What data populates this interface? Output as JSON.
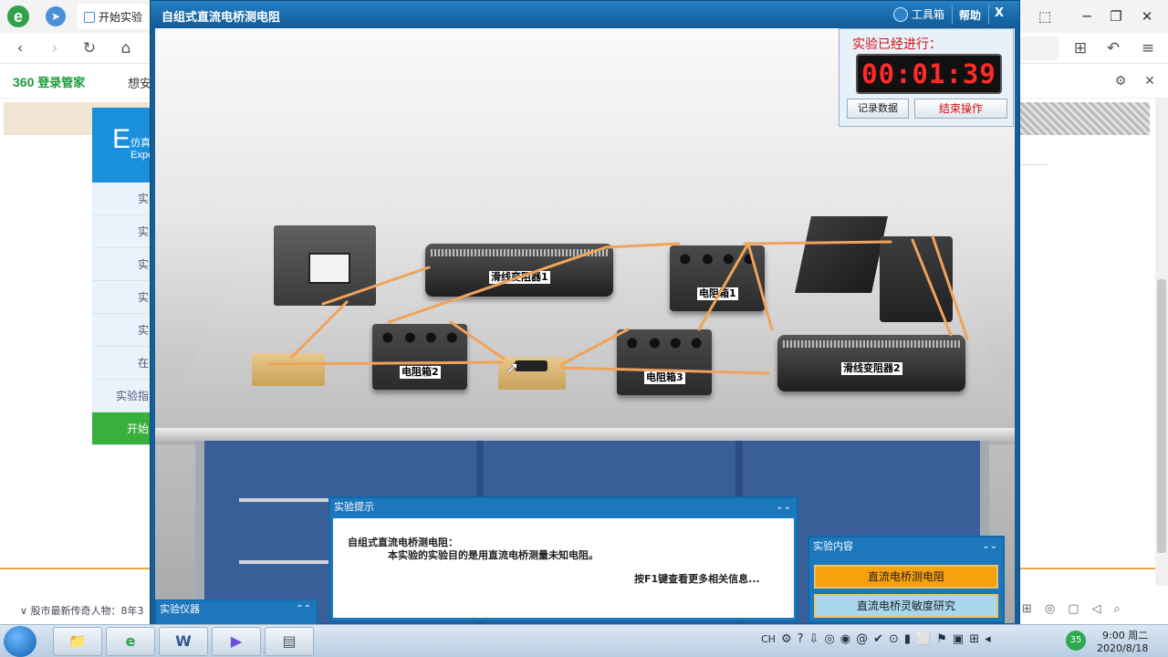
{
  "browser": {
    "logo_glyph": "e",
    "tab_title": "开始实验",
    "window_controls": [
      "⬚",
      "─",
      "❐",
      "✕"
    ],
    "toolbar": {
      "back": "‹",
      "forward": "›",
      "reload": "↻",
      "home": "⌂",
      "apps": "⊞",
      "undo": "↶",
      "menu": "≡"
    },
    "bookmarks": {
      "brand": "360",
      "login": "登录管家",
      "item": "想安",
      "settings": "⚙",
      "close": "✕"
    }
  },
  "background_page": {
    "logo_letter": "E",
    "logo_text_top": "仿真",
    "logo_text_bottom": "Expe",
    "side_items": [
      "实",
      "实",
      "实",
      "实",
      "实",
      "在",
      "实验指"
    ],
    "start_item": "开始",
    "ticker": "股市最新传奇人物：8年3"
  },
  "simulation": {
    "title": "自组式直流电桥测电阻",
    "toolbox_label": "工具箱",
    "help_label": "帮助",
    "close_label": "X",
    "timer": {
      "label": "实验已经进行：",
      "value": "00:01:39",
      "record_button": "记录数据",
      "end_button": "结束操作"
    },
    "devices": {
      "rheostat1": "滑线变阻器1",
      "rheostat2": "滑线变阻器2",
      "resistor1": "电阻箱1",
      "resistor2": "电阻箱2",
      "resistor3": "电阻箱3"
    },
    "hint_panel": {
      "title": "实验提示",
      "heading": "自组式直流电桥测电阻：",
      "text": "本实验的实验目的是用直流电桥测量未知电阻。",
      "more": "按F1键查看更多相关信息..."
    },
    "content_panel": {
      "title": "实验内容",
      "items": [
        "直流电桥测电阻",
        "直流电桥灵敏度研究"
      ]
    },
    "instrument_panel": {
      "title": "实验仪器"
    },
    "colors": {
      "wire": "#f0a35a",
      "title_bar": "#1a6fb0",
      "timer_digits": "#ff2a2a",
      "active_item": "#f7a10f"
    }
  },
  "taskbar": {
    "apps": [
      "📁",
      "e",
      "W",
      "▶",
      "▤"
    ],
    "tray_lang": "CH",
    "badge": "35",
    "time": "9:00 周二",
    "date": "2020/8/18"
  }
}
